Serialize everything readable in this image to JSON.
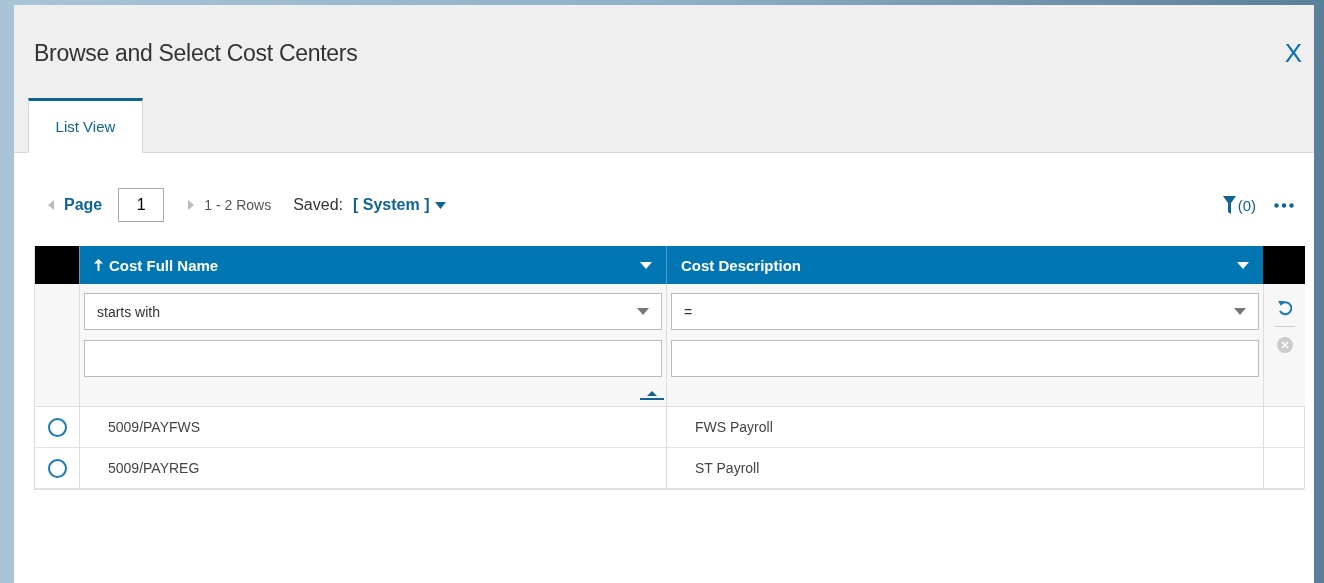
{
  "dialog": {
    "title": "Browse and Select Cost Centers",
    "close": "X"
  },
  "tabs": [
    {
      "label": "List View",
      "selected": true
    }
  ],
  "toolbar": {
    "page_label": "Page",
    "page": "1",
    "rows": "1 - 2 Rows",
    "saved_label": "Saved:",
    "saved_value": "[ System ]",
    "filter_count": "(0)"
  },
  "table": {
    "columns": [
      {
        "label": "Cost Full Name",
        "sorted": true,
        "operator": "starts with"
      },
      {
        "label": "Cost Description",
        "sorted": false,
        "operator": "="
      }
    ],
    "rows": [
      {
        "selected": false,
        "cells": [
          "5009/PAYFWS",
          "FWS Payroll"
        ]
      },
      {
        "selected": false,
        "cells": [
          "5009/PAYREG",
          "ST Payroll"
        ]
      }
    ]
  }
}
